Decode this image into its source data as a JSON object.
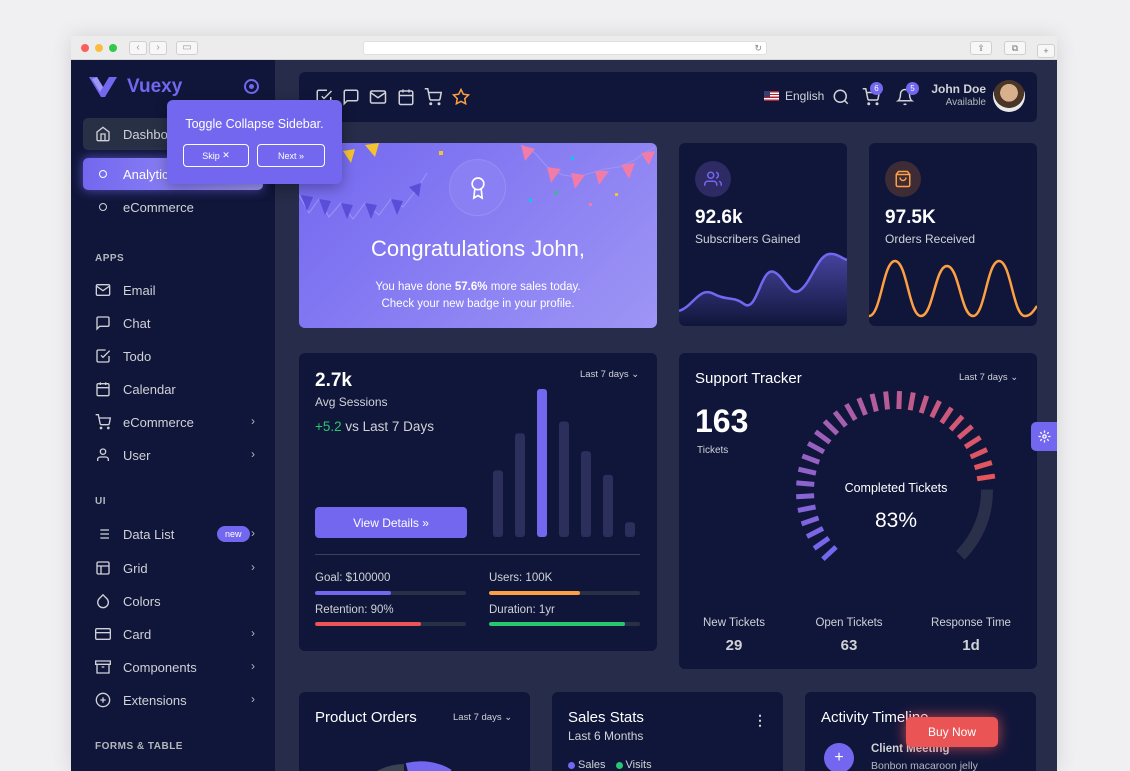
{
  "brand": {
    "name": "Vuexy"
  },
  "tour": {
    "text": "Toggle Collapse Sidebar.",
    "skip_label": "Skip",
    "next_label": "Next"
  },
  "sidebar": {
    "dashboard_label": "Dashboard",
    "sub_items": [
      {
        "label": "Analytics"
      },
      {
        "label": "eCommerce"
      }
    ],
    "sections": {
      "apps": "APPS",
      "ui": "UI",
      "forms": "FORMS & TABLE"
    },
    "apps": [
      {
        "label": "Email",
        "icon": "mail-icon"
      },
      {
        "label": "Chat",
        "icon": "message-square-icon"
      },
      {
        "label": "Todo",
        "icon": "check-square-icon"
      },
      {
        "label": "Calendar",
        "icon": "calendar-icon"
      },
      {
        "label": "eCommerce",
        "icon": "shopping-cart-icon"
      },
      {
        "label": "User",
        "icon": "user-icon"
      }
    ],
    "ui": [
      {
        "label": "Data List",
        "icon": "list-icon",
        "badge": "new"
      },
      {
        "label": "Grid",
        "icon": "layout-icon"
      },
      {
        "label": "Colors",
        "icon": "droplet-icon"
      },
      {
        "label": "Card",
        "icon": "credit-card-icon"
      },
      {
        "label": "Components",
        "icon": "archive-icon"
      },
      {
        "label": "Extensions",
        "icon": "plus-circle-icon"
      }
    ]
  },
  "navbar": {
    "language": "English",
    "cart_count": "6",
    "notif_count": "5",
    "user_name": "John Doe",
    "user_status": "Available"
  },
  "congrats": {
    "title": "Congratulations John,",
    "line1_prefix": "You have done ",
    "line1_value": "57.6%",
    "line1_suffix": " more sales today.",
    "line2": "Check your new badge in your profile."
  },
  "subscribers": {
    "value": "92.6k",
    "label": "Subscribers Gained"
  },
  "orders": {
    "value": "97.5K",
    "label": "Orders Received"
  },
  "sessions": {
    "value": "2.7k",
    "label": "Avg Sessions",
    "change": "+5.2",
    "change_suffix": " vs Last 7 Days",
    "range": "Last 7 days",
    "button": "View Details",
    "bars": [
      0.45,
      0.7,
      1.0,
      0.78,
      0.58,
      0.42,
      0.1
    ],
    "goal": {
      "label": "Goal: $100000",
      "level": 0.5,
      "color": "#7367f0"
    },
    "users": {
      "label": "Users: 100K",
      "level": 0.6,
      "color": "#ff9f43"
    },
    "retention": {
      "label": "Retention: 90%",
      "level": 0.7,
      "color": "#ea5455"
    },
    "duration": {
      "label": "Duration: 1yr",
      "level": 0.9,
      "color": "#28c76f"
    }
  },
  "support": {
    "title": "Support Tracker",
    "range": "Last 7 days",
    "tickets": "163",
    "tickets_label": "Tickets",
    "gauge_label": "Completed Tickets",
    "gauge_value": "83%",
    "completed_fraction": 0.83,
    "stats": [
      {
        "label": "New Tickets",
        "value": "29"
      },
      {
        "label": "Open Tickets",
        "value": "63"
      },
      {
        "label": "Response Time",
        "value": "1d"
      }
    ]
  },
  "product_orders": {
    "title": "Product Orders",
    "range": "Last 7 days"
  },
  "sales_stats": {
    "title": "Sales Stats",
    "subtitle": "Last 6 Months",
    "legend": [
      "Sales",
      "Visits"
    ]
  },
  "activity": {
    "title": "Activity Timeline",
    "item_title": "Client Meeting",
    "item_text": "Bonbon macaroon jelly"
  },
  "buy_now": "Buy Now",
  "colors": {
    "primary": "#7367f0",
    "danger": "#ea5455",
    "warning": "#ff9f43",
    "success": "#28c76f"
  }
}
